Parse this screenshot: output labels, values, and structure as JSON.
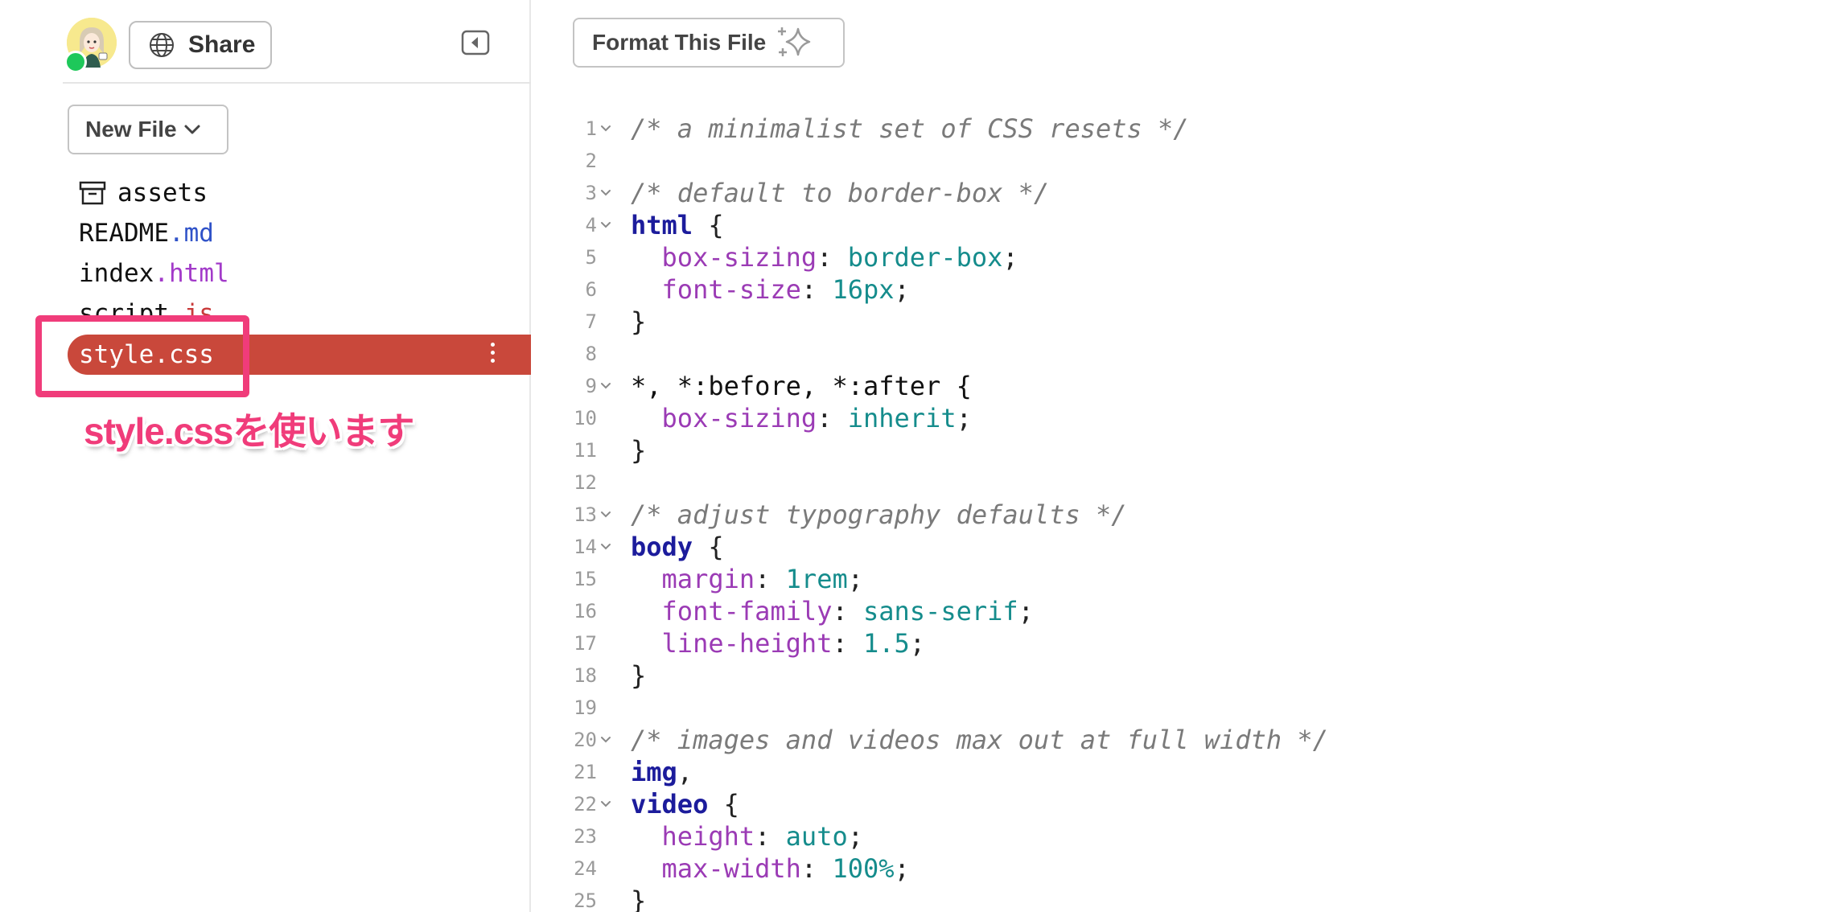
{
  "sidebar": {
    "share_label": "Share",
    "new_file_label": "New File",
    "files": [
      {
        "base": "assets",
        "ext": "",
        "type": "folder"
      },
      {
        "base": "README",
        "ext": ".md",
        "type": "file"
      },
      {
        "base": "index",
        "ext": ".html",
        "type": "file"
      },
      {
        "base": "script",
        "ext": ".js",
        "type": "file"
      },
      {
        "base": "style.css",
        "ext": "",
        "type": "file",
        "active": true
      }
    ]
  },
  "annotation": {
    "text": "style.cssを使います",
    "color": "#f03c7a"
  },
  "editor": {
    "format_label": "Format This File",
    "lines": [
      {
        "n": "1",
        "fold": true,
        "tokens": [
          {
            "t": "/* a minimalist set of CSS resets */",
            "c": "comment"
          }
        ]
      },
      {
        "n": "2",
        "fold": false,
        "tokens": []
      },
      {
        "n": "3",
        "fold": true,
        "tokens": [
          {
            "t": "/* default to border-box */",
            "c": "comment"
          }
        ]
      },
      {
        "n": "4",
        "fold": true,
        "tokens": [
          {
            "t": "html",
            "c": "selector"
          },
          {
            "t": " {",
            "c": "punct"
          }
        ]
      },
      {
        "n": "5",
        "fold": false,
        "tokens": [
          {
            "t": "  ",
            "c": "plain"
          },
          {
            "t": "box-sizing",
            "c": "prop"
          },
          {
            "t": ": ",
            "c": "punct"
          },
          {
            "t": "border-box",
            "c": "value"
          },
          {
            "t": ";",
            "c": "punct"
          }
        ]
      },
      {
        "n": "6",
        "fold": false,
        "tokens": [
          {
            "t": "  ",
            "c": "plain"
          },
          {
            "t": "font-size",
            "c": "prop"
          },
          {
            "t": ": ",
            "c": "punct"
          },
          {
            "t": "16px",
            "c": "value"
          },
          {
            "t": ";",
            "c": "punct"
          }
        ]
      },
      {
        "n": "7",
        "fold": false,
        "tokens": [
          {
            "t": "}",
            "c": "punct"
          }
        ]
      },
      {
        "n": "8",
        "fold": false,
        "tokens": []
      },
      {
        "n": "9",
        "fold": true,
        "tokens": [
          {
            "t": "*, *:before, *:after {",
            "c": "plain"
          }
        ]
      },
      {
        "n": "10",
        "fold": false,
        "tokens": [
          {
            "t": "  ",
            "c": "plain"
          },
          {
            "t": "box-sizing",
            "c": "prop"
          },
          {
            "t": ": ",
            "c": "punct"
          },
          {
            "t": "inherit",
            "c": "value"
          },
          {
            "t": ";",
            "c": "punct"
          }
        ]
      },
      {
        "n": "11",
        "fold": false,
        "tokens": [
          {
            "t": "}",
            "c": "punct"
          }
        ]
      },
      {
        "n": "12",
        "fold": false,
        "tokens": []
      },
      {
        "n": "13",
        "fold": true,
        "tokens": [
          {
            "t": "/* adjust typography defaults */",
            "c": "comment"
          }
        ]
      },
      {
        "n": "14",
        "fold": true,
        "tokens": [
          {
            "t": "body",
            "c": "selector"
          },
          {
            "t": " {",
            "c": "punct"
          }
        ]
      },
      {
        "n": "15",
        "fold": false,
        "tokens": [
          {
            "t": "  ",
            "c": "plain"
          },
          {
            "t": "margin",
            "c": "prop"
          },
          {
            "t": ": ",
            "c": "punct"
          },
          {
            "t": "1rem",
            "c": "value"
          },
          {
            "t": ";",
            "c": "punct"
          }
        ]
      },
      {
        "n": "16",
        "fold": false,
        "tokens": [
          {
            "t": "  ",
            "c": "plain"
          },
          {
            "t": "font-family",
            "c": "prop"
          },
          {
            "t": ": ",
            "c": "punct"
          },
          {
            "t": "sans-serif",
            "c": "value"
          },
          {
            "t": ";",
            "c": "punct"
          }
        ]
      },
      {
        "n": "17",
        "fold": false,
        "tokens": [
          {
            "t": "  ",
            "c": "plain"
          },
          {
            "t": "line-height",
            "c": "prop"
          },
          {
            "t": ": ",
            "c": "punct"
          },
          {
            "t": "1.5",
            "c": "value"
          },
          {
            "t": ";",
            "c": "punct"
          }
        ]
      },
      {
        "n": "18",
        "fold": false,
        "tokens": [
          {
            "t": "}",
            "c": "punct"
          }
        ]
      },
      {
        "n": "19",
        "fold": false,
        "tokens": []
      },
      {
        "n": "20",
        "fold": true,
        "tokens": [
          {
            "t": "/* images and videos max out at full width */",
            "c": "comment"
          }
        ]
      },
      {
        "n": "21",
        "fold": false,
        "tokens": [
          {
            "t": "img",
            "c": "selector"
          },
          {
            "t": ",",
            "c": "punct"
          }
        ]
      },
      {
        "n": "22",
        "fold": true,
        "tokens": [
          {
            "t": "video",
            "c": "selector"
          },
          {
            "t": " {",
            "c": "punct"
          }
        ]
      },
      {
        "n": "23",
        "fold": false,
        "tokens": [
          {
            "t": "  ",
            "c": "plain"
          },
          {
            "t": "height",
            "c": "prop"
          },
          {
            "t": ": ",
            "c": "punct"
          },
          {
            "t": "auto",
            "c": "value"
          },
          {
            "t": ";",
            "c": "punct"
          }
        ]
      },
      {
        "n": "24",
        "fold": false,
        "tokens": [
          {
            "t": "  ",
            "c": "plain"
          },
          {
            "t": "max-width",
            "c": "prop"
          },
          {
            "t": ": ",
            "c": "punct"
          },
          {
            "t": "100%",
            "c": "value"
          },
          {
            "t": ";",
            "c": "punct"
          }
        ]
      },
      {
        "n": "25",
        "fold": false,
        "tokens": [
          {
            "t": "}",
            "c": "punct"
          }
        ]
      }
    ]
  },
  "colors": {
    "active_file_bg": "#c9483b",
    "online_dot": "#1ec85a",
    "annotation": "#f03c7a",
    "avatar_bg": "#f7e98e"
  },
  "icons": {
    "avatar": "user-avatar",
    "share": "globe-icon",
    "collapse": "collapse-sidebar-icon",
    "new_file": "chevron-down-icon",
    "folder": "archive-box-icon",
    "format": "sparkles-icon",
    "file_menu": "kebab-menu-icon"
  }
}
